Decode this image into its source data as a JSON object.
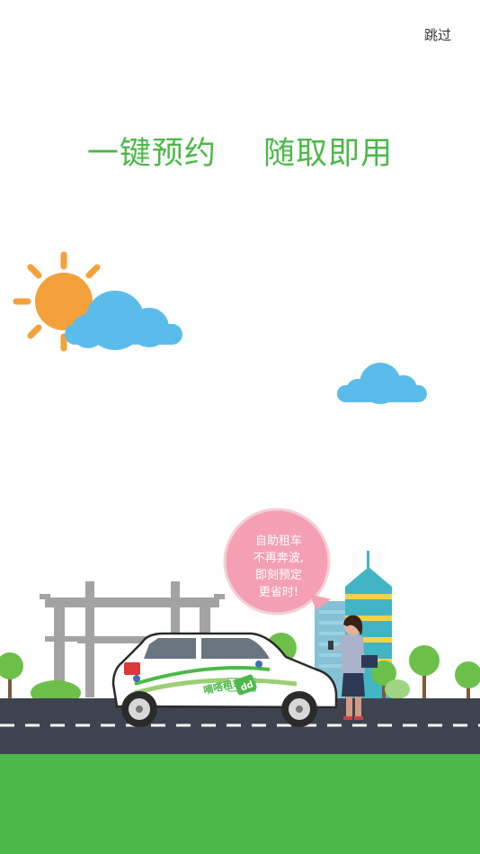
{
  "header": {
    "skip_label": "跳过"
  },
  "headline": {
    "part1": "一键预约",
    "part2": "随取即用"
  },
  "speech_bubble": {
    "line1": "自助租车",
    "line2": "不再奔波,",
    "line3": "即刻预定",
    "line4": "更省时!"
  },
  "car": {
    "brand_text": "嘀嗒租车",
    "badge": "dd"
  },
  "colors": {
    "headline": "#4cb849",
    "sun": "#f4a13c",
    "cloud": "#5bbcec",
    "bubble": "#f4a0b2",
    "road": "#3d4450",
    "grass": "#4cb849",
    "tree": "#6cc04a",
    "gate": "#9a9a9a",
    "tower": "#43b4c4"
  }
}
